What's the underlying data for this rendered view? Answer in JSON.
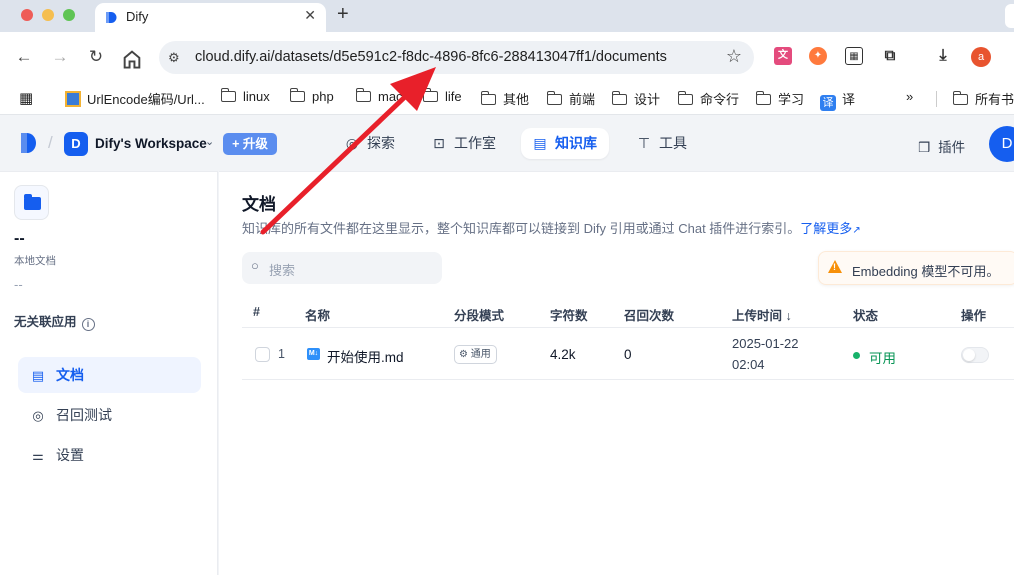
{
  "browser": {
    "tab_title": "Dify",
    "url": "cloud.dify.ai/datasets/d5e591c2-f8dc-4896-8fc6-288413047ff1/documents",
    "profile_initial": "a",
    "bookmarks": [
      "UrlEncode编码/Url...",
      "linux",
      "php",
      "mac",
      "life",
      "其他",
      "前端",
      "设计",
      "命令行",
      "学习",
      "译",
      "所有书"
    ]
  },
  "app": {
    "workspace_initial": "D",
    "workspace_name": "Dify's Workspace",
    "upgrade_label": "升级",
    "nav": [
      "探索",
      "工作室",
      "知识库",
      "工具"
    ],
    "plugin_label": "插件",
    "user_initial": "D"
  },
  "sidebar": {
    "dataset_name": "--",
    "dataset_type": "本地文档",
    "dataset_desc": "--",
    "related_apps": "无关联应用",
    "items": [
      "文档",
      "召回测试",
      "设置"
    ]
  },
  "main": {
    "title": "文档",
    "description": "知识库的所有文件都在这里显示，整个知识库都可以链接到 Dify 引用或通过 Chat 插件进行索引。",
    "learn_more": "了解更多",
    "search_placeholder": "搜索",
    "warning": "Embedding 模型不可用。",
    "columns": [
      "#",
      "名称",
      "分段模式",
      "字符数",
      "召回次数",
      "上传时间",
      "状态",
      "操作"
    ],
    "rows": [
      {
        "index": "1",
        "name": "开始使用.md",
        "mode": "通用",
        "chars": "4.2k",
        "hits": "0",
        "date": "2025-01-22",
        "time": "02:04",
        "status": "可用"
      }
    ]
  },
  "colors": {
    "accent": "#155eef",
    "status_ok": "#17b26a",
    "warning": "#f79009",
    "annotation_arrow": "#e8202a"
  }
}
